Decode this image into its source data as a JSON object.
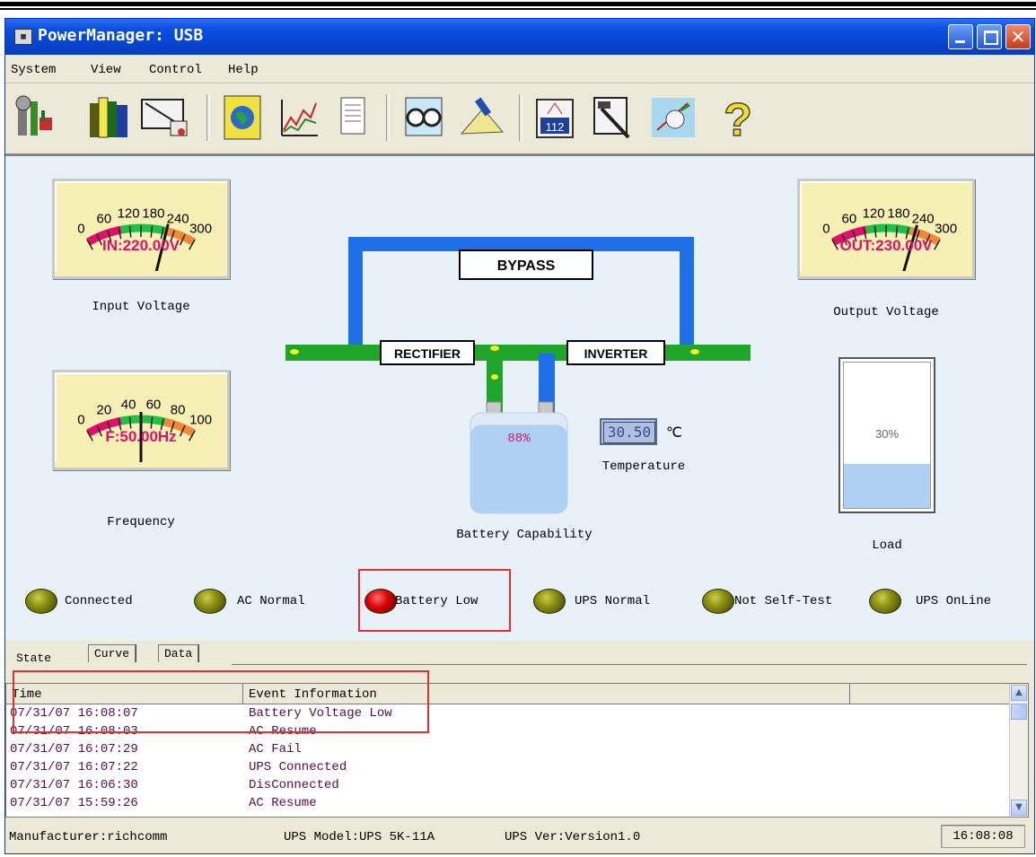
{
  "window": {
    "title": "PowerManager: USB"
  },
  "menu": [
    "System",
    "View",
    "Control",
    "Help"
  ],
  "toolbar": [
    "settings-tools-icon",
    "books-icon",
    "monitor-doc-icon",
    "globe-icon",
    "chart-icon",
    "notepad-icon",
    "glasses-icon",
    "brush-icon",
    "calendar-icon",
    "hammer-icon",
    "satellite-icon",
    "help-icon"
  ],
  "meters": {
    "input": {
      "scale": [
        "0",
        "60",
        "120",
        "180",
        "240",
        "300"
      ],
      "readout": "IN:220.00V",
      "caption": "Input Voltage",
      "value": 220
    },
    "output": {
      "scale": [
        "0",
        "60",
        "120",
        "180",
        "240",
        "300"
      ],
      "readout": "OUT:230.00V",
      "caption": "Output Voltage",
      "value": 230
    },
    "frequency": {
      "scale": [
        "0",
        "20",
        "40",
        "60",
        "80",
        "100"
      ],
      "readout": "F:50.00Hz",
      "caption": "Frequency",
      "value": 50
    }
  },
  "diagram": {
    "bypass": "BYPASS",
    "rectifier": "RECTIFIER",
    "inverter": "INVERTER"
  },
  "battery": {
    "percent": "88%",
    "level": 0.88,
    "caption": "Battery Capability"
  },
  "temperature": {
    "value": "30.50",
    "unit": "℃",
    "caption": "Temperature"
  },
  "load": {
    "percent": "30%",
    "level": 0.3,
    "caption": "Load"
  },
  "status": [
    {
      "label": "Connected",
      "state": "ok"
    },
    {
      "label": "AC Normal",
      "state": "ok"
    },
    {
      "label": "Battery Low",
      "state": "alarm"
    },
    {
      "label": "UPS Normal",
      "state": "ok"
    },
    {
      "label": "Not Self-Test",
      "state": "ok"
    },
    {
      "label": "UPS OnLine",
      "state": "ok"
    }
  ],
  "tabs": [
    "State",
    "Curve",
    "Data"
  ],
  "events": {
    "columns": [
      "Time",
      "Event Information"
    ],
    "rows": [
      [
        "07/31/07 16:08:07",
        "Battery Voltage Low"
      ],
      [
        "07/31/07 16:08:03",
        "AC Resume"
      ],
      [
        "07/31/07 16:07:29",
        "AC Fail"
      ],
      [
        "07/31/07 16:07:22",
        "UPS Connected"
      ],
      [
        "07/31/07 16:06:30",
        "DisConnected"
      ],
      [
        "07/31/07 15:59:26",
        "AC Resume"
      ]
    ]
  },
  "statusbar": {
    "manufacturer": "Manufacturer:richcomm",
    "model": "UPS Model:UPS 5K-11A",
    "version": "UPS Ver:Version1.0",
    "clock": "16:08:08"
  },
  "colors": {
    "titlebar": "#0a4ee0",
    "pipe_green": "#1fa52a",
    "pipe_blue": "#1f6fe6",
    "readout": "#e0106a",
    "alarm": "#e03030"
  }
}
